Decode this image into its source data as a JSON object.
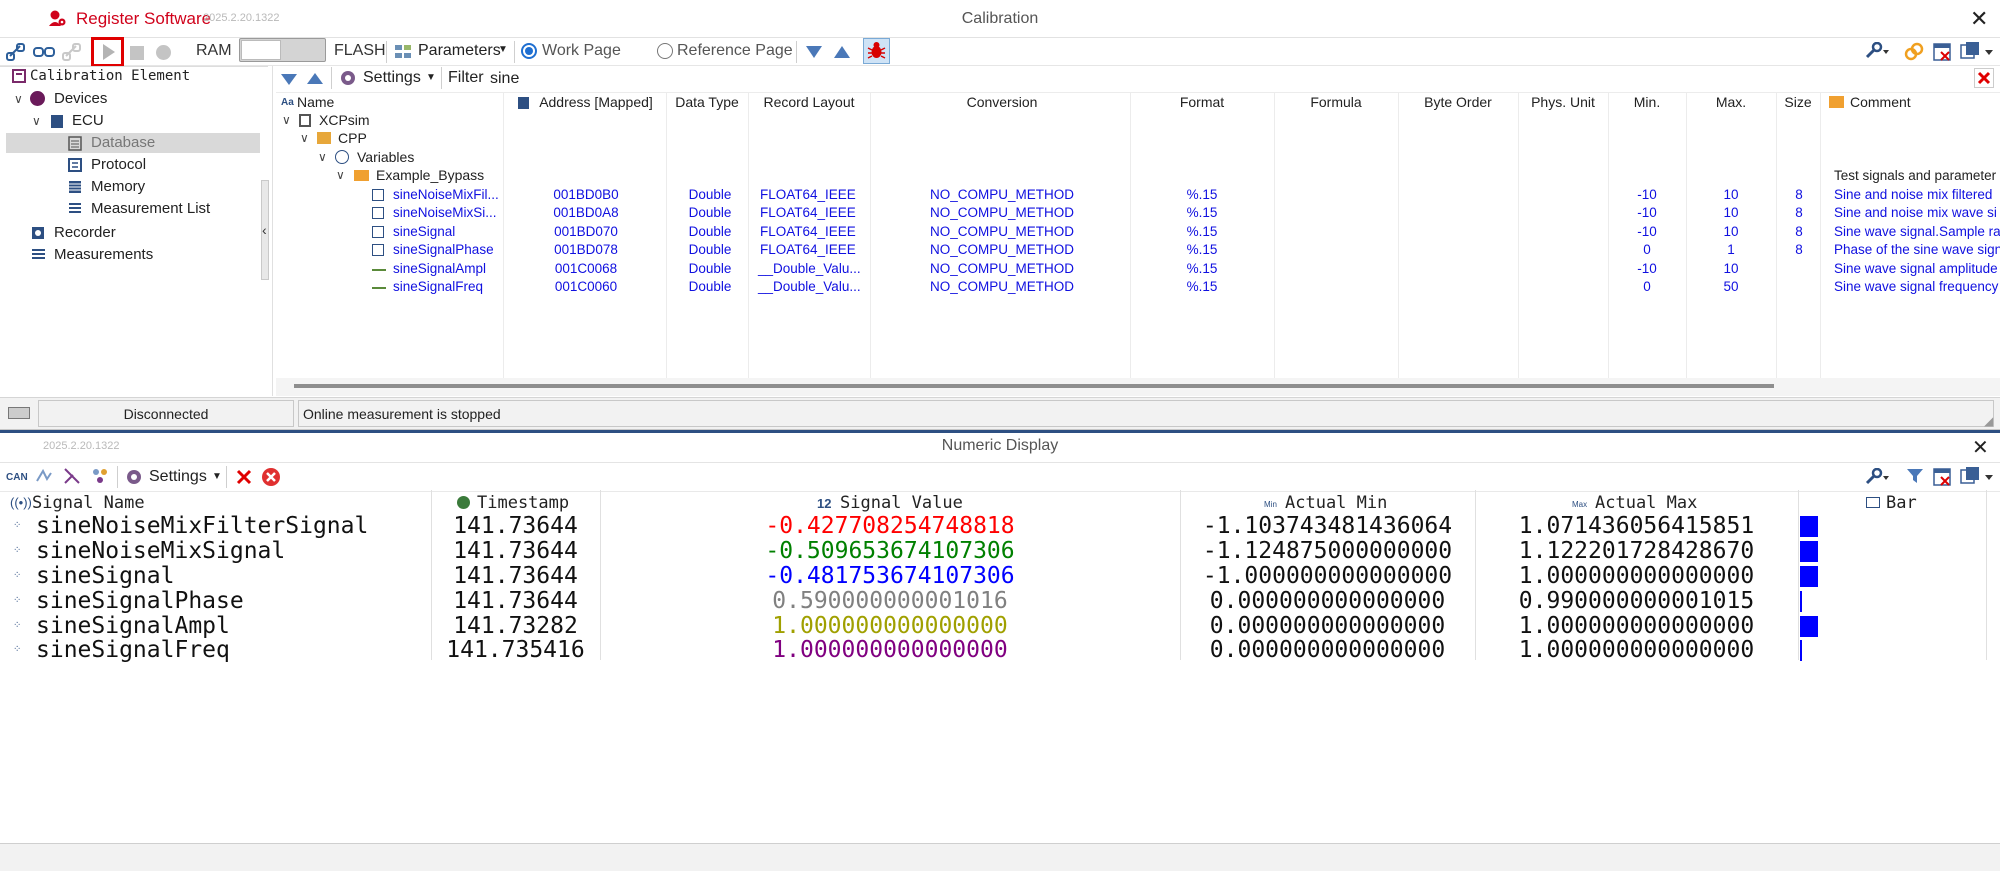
{
  "title_bar": {
    "app_name": "Register Software",
    "version": "2025.2.20.1322",
    "window_title": "Calibration",
    "close_glyph": "✕"
  },
  "toolbar": {
    "ram_label": "RAM",
    "flash_label": "FLASH",
    "parameters_label": "Parameters",
    "work_page_label": "Work Page",
    "reference_page_label": "Reference Page"
  },
  "tree": {
    "header": "Calibration Element",
    "items": [
      {
        "label": "Devices"
      },
      {
        "label": "ECU"
      },
      {
        "label": "Database"
      },
      {
        "label": "Protocol"
      },
      {
        "label": "Memory"
      },
      {
        "label": "Measurement List"
      },
      {
        "label": "Recorder"
      },
      {
        "label": "Measurements"
      }
    ]
  },
  "grid_toolbar": {
    "settings_label": "Settings",
    "filter_label": "Filter",
    "filter_value": "sine"
  },
  "grid": {
    "columns": [
      "Name",
      "Address [Mapped]",
      "Data Type",
      "Record Layout",
      "Conversion",
      "Format",
      "Formula",
      "Byte Order",
      "Phys. Unit",
      "Min.",
      "Max.",
      "Size",
      "Comment"
    ],
    "tree_nodes": [
      "XCPsim",
      "CPP",
      "Variables",
      "Example_Bypass"
    ],
    "group_comment": "Test signals and parameter",
    "rows": [
      {
        "name": "sineNoiseMixFil...",
        "address": "001BD0B0",
        "type": "Double",
        "layout": "FLOAT64_IEEE",
        "conversion": "NO_COMPU_METHOD",
        "format": "%.15",
        "min": "-10",
        "max": "10",
        "size": "8",
        "comment": "Sine and noise mix filtered"
      },
      {
        "name": "sineNoiseMixSi...",
        "address": "001BD0A8",
        "type": "Double",
        "layout": "FLOAT64_IEEE",
        "conversion": "NO_COMPU_METHOD",
        "format": "%.15",
        "min": "-10",
        "max": "10",
        "size": "8",
        "comment": "Sine and noise mix wave si"
      },
      {
        "name": "sineSignal",
        "address": "001BD070",
        "type": "Double",
        "layout": "FLOAT64_IEEE",
        "conversion": "NO_COMPU_METHOD",
        "format": "%.15",
        "min": "-10",
        "max": "10",
        "size": "8",
        "comment": "Sine wave signal.Sample ra"
      },
      {
        "name": "sineSignalPhase",
        "address": "001BD078",
        "type": "Double",
        "layout": "FLOAT64_IEEE",
        "conversion": "NO_COMPU_METHOD",
        "format": "%.15",
        "min": "0",
        "max": "1",
        "size": "8",
        "comment": "Phase of the sine wave sign"
      },
      {
        "name": "sineSignalAmpl",
        "address": "001C0068",
        "type": "Double",
        "layout": "__Double_Valu...",
        "conversion": "NO_COMPU_METHOD",
        "format": "%.15",
        "min": "-10",
        "max": "10",
        "size": "",
        "comment": "Sine wave signal amplitude"
      },
      {
        "name": "sineSignalFreq",
        "address": "001C0060",
        "type": "Double",
        "layout": "__Double_Valu...",
        "conversion": "NO_COMPU_METHOD",
        "format": "%.15",
        "min": "0",
        "max": "50",
        "size": "",
        "comment": "Sine wave signal frequency"
      }
    ]
  },
  "status": {
    "connection": "Disconnected",
    "message": "Online measurement is stopped"
  },
  "numeric_display": {
    "version": "2025.2.20.1322",
    "title": "Numeric Display",
    "settings_label": "Settings",
    "columns": [
      "Signal Name",
      "Timestamp",
      "Signal Value",
      "Actual Min",
      "Actual Max",
      "Bar"
    ],
    "col_icons": {
      "value": "12",
      "min": "Min",
      "max": "Max"
    },
    "rows": [
      {
        "name": "sineNoiseMixFilterSignal",
        "timestamp": "141.73644",
        "value": "-0.427708254748818",
        "value_color": "#ff0000",
        "min": "-1.103743481436064",
        "max": "1.071436056415851",
        "bar_fraction": 1.0
      },
      {
        "name": "sineNoiseMixSignal",
        "timestamp": "141.73644",
        "value": "-0.509653674107306",
        "value_color": "#008000",
        "min": "-1.124875000000000",
        "max": "1.122201728428670",
        "bar_fraction": 1.0
      },
      {
        "name": "sineSignal",
        "timestamp": "141.73644",
        "value": "-0.481753674107306",
        "value_color": "#0000ff",
        "min": "-1.000000000000000",
        "max": "1.000000000000000",
        "bar_fraction": 1.0
      },
      {
        "name": "sineSignalPhase",
        "timestamp": "141.73644",
        "value": "0.590000000001016",
        "value_color": "#808080",
        "min": "0.000000000000000",
        "max": "0.990000000001015",
        "bar_fraction": 0.1
      },
      {
        "name": "sineSignalAmpl",
        "timestamp": "141.73282",
        "value": "1.000000000000000",
        "value_color": "#a0a000",
        "min": "0.000000000000000",
        "max": "1.000000000000000",
        "bar_fraction": 1.0
      },
      {
        "name": "sineSignalFreq",
        "timestamp": "141.735416",
        "value": "1.000000000000000",
        "value_color": "#800080",
        "min": "0.000000000000000",
        "max": "1.000000000000000",
        "bar_fraction": 0.1
      }
    ]
  },
  "colors": {
    "accent_red": "#e00000",
    "grid_text": "#1010e0",
    "bar": "#0000ff"
  }
}
